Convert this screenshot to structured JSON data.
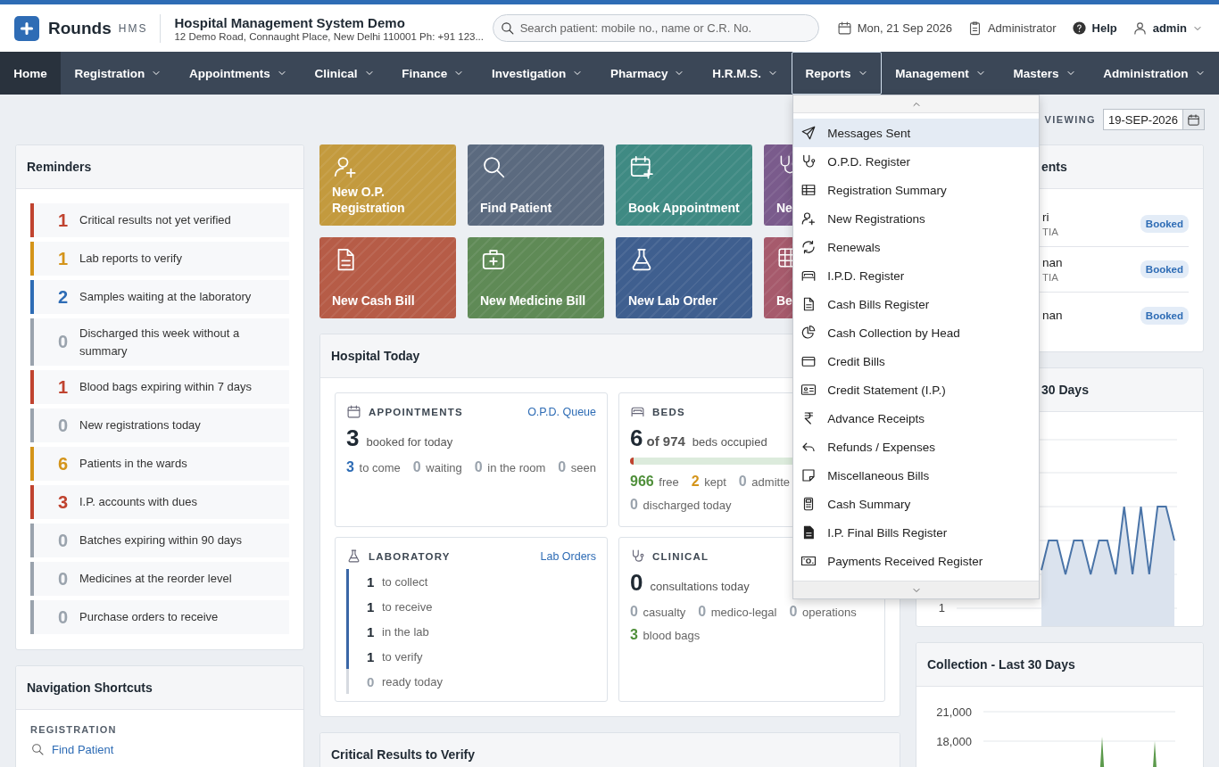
{
  "header": {
    "logo": "Rounds",
    "logo_suffix": "HMS",
    "hospital_name": "Hospital Management System Demo",
    "address": "12 Demo Road, Connaught Place, New Delhi 110001 Ph: +91 123...",
    "search": {
      "placeholder": "Search patient: mobile no., name or C.R. No."
    },
    "date": "Mon, 21 Sep 2026",
    "role": "Administrator",
    "help": "Help",
    "user": "admin"
  },
  "nav": [
    {
      "label": "Home",
      "selected": true,
      "open": false,
      "has_menu": false
    },
    {
      "label": "Registration",
      "selected": false,
      "open": false,
      "has_menu": true
    },
    {
      "label": "Appointments",
      "selected": false,
      "open": false,
      "has_menu": true
    },
    {
      "label": "Clinical",
      "selected": false,
      "open": false,
      "has_menu": true
    },
    {
      "label": "Finance",
      "selected": false,
      "open": false,
      "has_menu": true
    },
    {
      "label": "Investigation",
      "selected": false,
      "open": false,
      "has_menu": true
    },
    {
      "label": "Pharmacy",
      "selected": false,
      "open": false,
      "has_menu": true
    },
    {
      "label": "H.R.M.S.",
      "selected": false,
      "open": false,
      "has_menu": true
    },
    {
      "label": "Reports",
      "selected": false,
      "open": true,
      "has_menu": true
    },
    {
      "label": "Management",
      "selected": false,
      "open": false,
      "has_menu": true
    },
    {
      "label": "Masters",
      "selected": false,
      "open": false,
      "has_menu": true
    },
    {
      "label": "Administration",
      "selected": false,
      "open": false,
      "has_menu": true
    }
  ],
  "reports_menu": {
    "items": [
      {
        "label": "Messages Sent",
        "selected": true
      },
      {
        "label": "O.P.D. Register",
        "selected": false
      },
      {
        "label": "Registration Summary",
        "selected": false
      },
      {
        "label": "New Registrations",
        "selected": false
      },
      {
        "label": "Renewals",
        "selected": false
      },
      {
        "label": "I.P.D. Register",
        "selected": false
      },
      {
        "label": "Cash Bills Register",
        "selected": false
      },
      {
        "label": "Cash Collection by Head",
        "selected": false
      },
      {
        "label": "Credit Bills",
        "selected": false
      },
      {
        "label": "Credit Statement (I.P.)",
        "selected": false
      },
      {
        "label": "Advance Receipts",
        "selected": false
      },
      {
        "label": "Refunds / Expenses",
        "selected": false
      },
      {
        "label": "Miscellaneous Bills",
        "selected": false
      },
      {
        "label": "Cash Summary",
        "selected": false
      },
      {
        "label": "I.P. Final Bills Register",
        "selected": false
      },
      {
        "label": "Payments Received Register",
        "selected": false
      }
    ]
  },
  "viewing": {
    "label": "VIEWING",
    "date": "19-SEP-2026"
  },
  "reminders": {
    "title": "Reminders",
    "items": [
      {
        "count": "1",
        "text": "Critical results not yet verified",
        "color": "#c0432f"
      },
      {
        "count": "1",
        "text": "Lab reports to verify",
        "color": "#d4941a"
      },
      {
        "count": "2",
        "text": "Samples waiting at the laboratory",
        "color": "#2e6cb5"
      },
      {
        "count": "0",
        "text": "Discharged this week without a summary",
        "color": "#9aa3ad"
      },
      {
        "count": "1",
        "text": "Blood bags expiring within 7 days",
        "color": "#c0432f"
      },
      {
        "count": "0",
        "text": "New registrations today",
        "color": "#9aa3ad"
      },
      {
        "count": "6",
        "text": "Patients in the wards",
        "color": "#d4941a"
      },
      {
        "count": "3",
        "text": "I.P. accounts with dues",
        "color": "#c0432f"
      },
      {
        "count": "0",
        "text": "Batches expiring within 90 days",
        "color": "#9aa3ad"
      },
      {
        "count": "0",
        "text": "Medicines at the reorder level",
        "color": "#9aa3ad"
      },
      {
        "count": "0",
        "text": "Purchase orders to receive",
        "color": "#9aa3ad"
      }
    ]
  },
  "shortcuts": {
    "title": "Navigation Shortcuts",
    "section": "REGISTRATION",
    "links": [
      "Find Patient"
    ]
  },
  "tiles": [
    {
      "label": "New O.P. Registration",
      "color": "#c39a3e"
    },
    {
      "label": "Find Patient",
      "color": "#5b6a7f"
    },
    {
      "label": "Book Appointment",
      "color": "#3f8a83"
    },
    {
      "label": "Ne",
      "color": "#7a5b8c"
    },
    {
      "label": "New Cash Bill",
      "color": "#b65c47"
    },
    {
      "label": "New Medicine Bill",
      "color": "#5f8a56"
    },
    {
      "label": "New Lab Order",
      "color": "#3f5f8f"
    },
    {
      "label": "Be",
      "color": "#a65a6c"
    }
  ],
  "hospital_today": {
    "title": "Hospital Today",
    "appointments": {
      "heading": "APPOINTMENTS",
      "link": "O.P.D. Queue",
      "count": "3",
      "caption": "booked for today",
      "stats": [
        {
          "text": "**3** to come",
          "color": "#2e6cb5"
        },
        {
          "text": "**0** waiting",
          "color": "#9aa3ad"
        },
        {
          "text": "**0** in the room",
          "color": "#9aa3ad"
        },
        {
          "text": "**0** seen",
          "color": "#9aa3ad"
        }
      ]
    },
    "beds": {
      "heading": "BEDS",
      "count": "6",
      "of": "of 974",
      "caption": "beds occupied",
      "level": 0.014,
      "stats": [
        {
          "text": "**966** free",
          "color": "#4f8f3a"
        },
        {
          "text": "**2** kept",
          "color": "#d4941a"
        },
        {
          "text": "**0** admitte",
          "color": "#9aa3ad"
        }
      ],
      "footer": {
        "text": "**0** discharged today",
        "color": "#9aa3ad"
      }
    },
    "laboratory": {
      "heading": "LABORATORY",
      "link": "Lab Orders",
      "rows": [
        {
          "value": "1",
          "label": "to collect",
          "active": true
        },
        {
          "value": "1",
          "label": "to receive",
          "active": true
        },
        {
          "value": "1",
          "label": "in the lab",
          "active": true
        },
        {
          "value": "1",
          "label": "to verify",
          "active": true
        },
        {
          "value": "0",
          "label": "ready today",
          "active": false
        }
      ]
    },
    "clinical": {
      "heading": "CLINICAL",
      "count": "0",
      "caption": "consultations today",
      "stats": [
        {
          "text": "**0** casualty",
          "color": "#9aa3ad"
        },
        {
          "text": "**0** medico-legal",
          "color": "#9aa3ad"
        },
        {
          "text": "**0** operations",
          "color": "#9aa3ad"
        }
      ],
      "footer": {
        "text": "**3** blood bags",
        "color": "#4f8f3a"
      }
    }
  },
  "critical_results": {
    "title": "Critical Results to Verify"
  },
  "appointments_panel": {
    "title": "ents",
    "rows": [
      {
        "name": "ri",
        "detail": "TIA",
        "status": "Booked"
      },
      {
        "name": "nan",
        "detail": "TIA",
        "status": "Booked"
      },
      {
        "name": "nan",
        "status": "Booked"
      }
    ]
  },
  "trend_chart": {
    "title": "30 Days",
    "ytick_labels": [
      "1"
    ]
  },
  "collection_chart": {
    "title": "Collection - Last 30 Days",
    "ytick_labels": [
      "21,000",
      "18,000"
    ]
  }
}
